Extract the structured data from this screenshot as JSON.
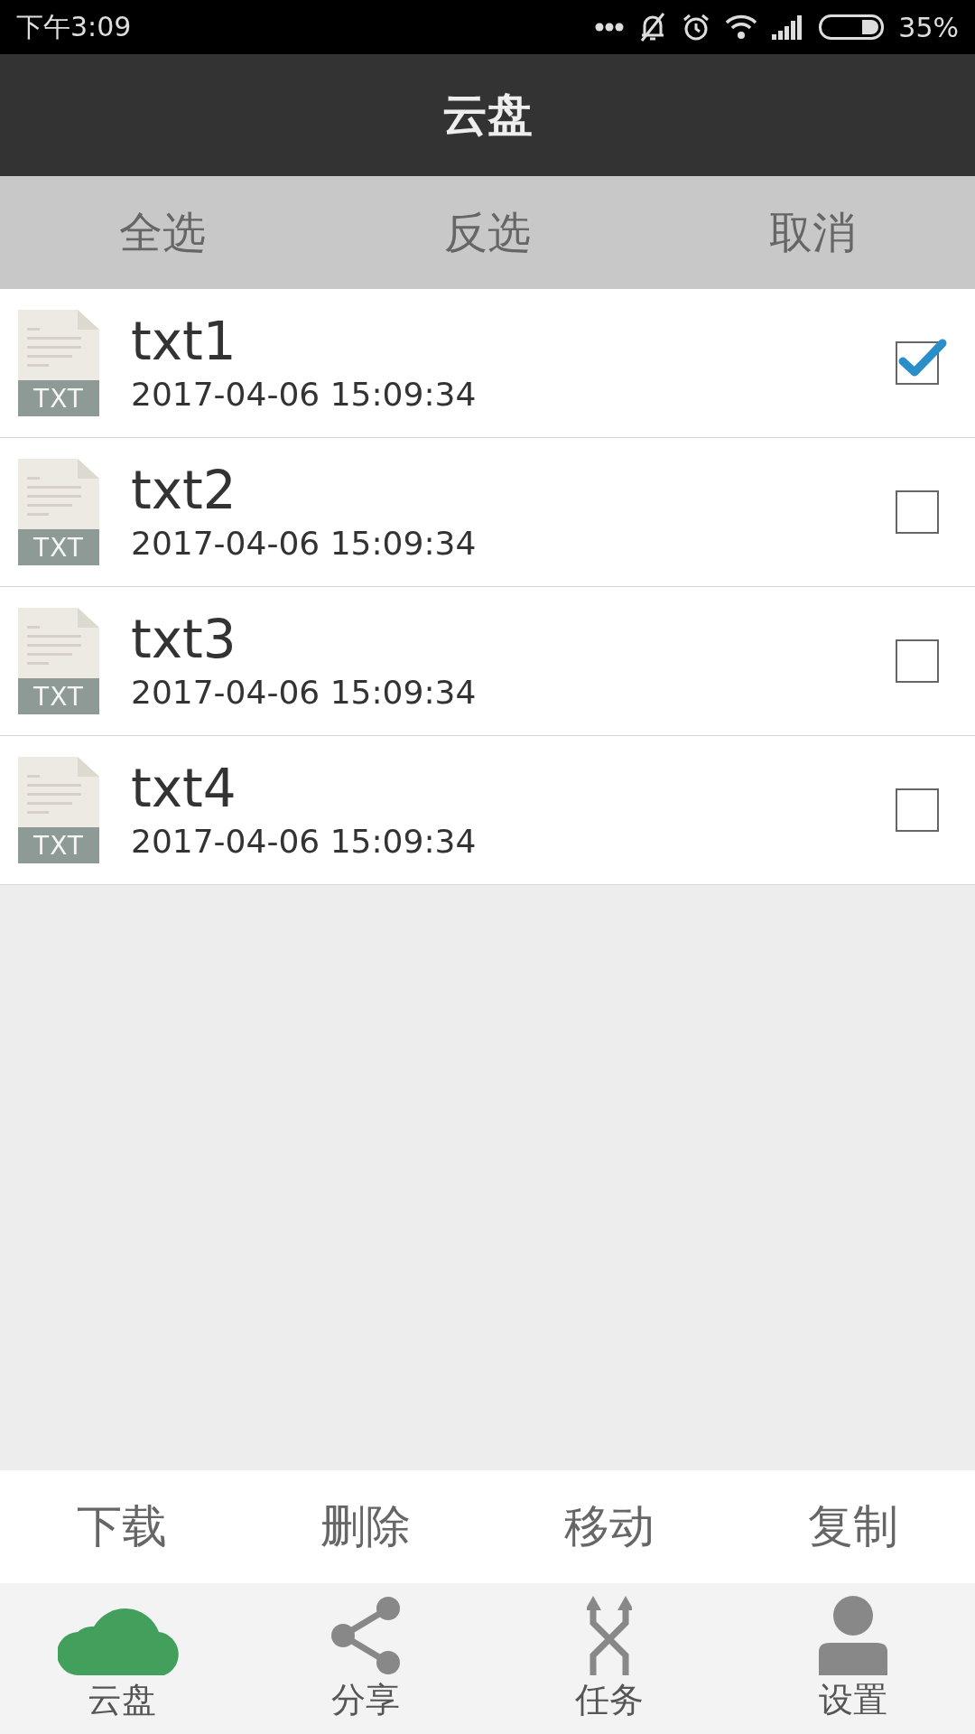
{
  "status_bar": {
    "time": "下午3:09",
    "battery": "35%"
  },
  "title": "云盘",
  "selection_bar": [
    "全选",
    "反选",
    "取消"
  ],
  "files": [
    {
      "name": "txt1",
      "date": "2017-04-06 15:09:34",
      "badge": "TXT",
      "checked": true
    },
    {
      "name": "txt2",
      "date": "2017-04-06 15:09:34",
      "badge": "TXT",
      "checked": false
    },
    {
      "name": "txt3",
      "date": "2017-04-06 15:09:34",
      "badge": "TXT",
      "checked": false
    },
    {
      "name": "txt4",
      "date": "2017-04-06 15:09:34",
      "badge": "TXT",
      "checked": false
    }
  ],
  "actions": [
    "下载",
    "删除",
    "移动",
    "复制"
  ],
  "tabs": [
    {
      "label": "云盘",
      "kind": "cloud",
      "selected": true
    },
    {
      "label": "分享",
      "kind": "share",
      "selected": false
    },
    {
      "label": "任务",
      "kind": "tasks",
      "selected": false
    },
    {
      "label": "设置",
      "kind": "user",
      "selected": false
    }
  ]
}
